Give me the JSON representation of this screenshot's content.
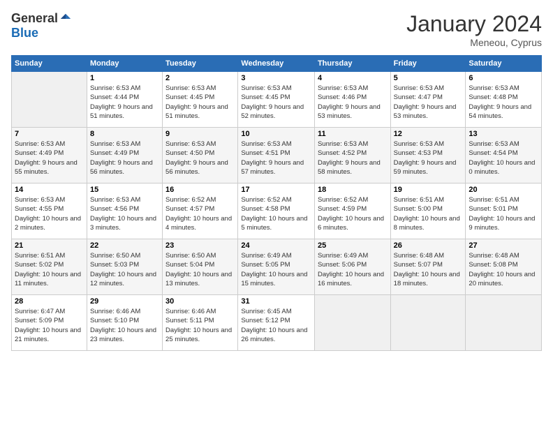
{
  "logo": {
    "general": "General",
    "blue": "Blue"
  },
  "header": {
    "title": "January 2024",
    "subtitle": "Meneou, Cyprus"
  },
  "weekdays": [
    "Sunday",
    "Monday",
    "Tuesday",
    "Wednesday",
    "Thursday",
    "Friday",
    "Saturday"
  ],
  "weeks": [
    [
      {
        "num": "",
        "empty": true
      },
      {
        "num": "1",
        "sunrise": "6:53 AM",
        "sunset": "4:44 PM",
        "daylight": "9 hours and 51 minutes."
      },
      {
        "num": "2",
        "sunrise": "6:53 AM",
        "sunset": "4:45 PM",
        "daylight": "9 hours and 51 minutes."
      },
      {
        "num": "3",
        "sunrise": "6:53 AM",
        "sunset": "4:45 PM",
        "daylight": "9 hours and 52 minutes."
      },
      {
        "num": "4",
        "sunrise": "6:53 AM",
        "sunset": "4:46 PM",
        "daylight": "9 hours and 53 minutes."
      },
      {
        "num": "5",
        "sunrise": "6:53 AM",
        "sunset": "4:47 PM",
        "daylight": "9 hours and 53 minutes."
      },
      {
        "num": "6",
        "sunrise": "6:53 AM",
        "sunset": "4:48 PM",
        "daylight": "9 hours and 54 minutes."
      }
    ],
    [
      {
        "num": "7",
        "sunrise": "6:53 AM",
        "sunset": "4:49 PM",
        "daylight": "9 hours and 55 minutes."
      },
      {
        "num": "8",
        "sunrise": "6:53 AM",
        "sunset": "4:49 PM",
        "daylight": "9 hours and 56 minutes."
      },
      {
        "num": "9",
        "sunrise": "6:53 AM",
        "sunset": "4:50 PM",
        "daylight": "9 hours and 56 minutes."
      },
      {
        "num": "10",
        "sunrise": "6:53 AM",
        "sunset": "4:51 PM",
        "daylight": "9 hours and 57 minutes."
      },
      {
        "num": "11",
        "sunrise": "6:53 AM",
        "sunset": "4:52 PM",
        "daylight": "9 hours and 58 minutes."
      },
      {
        "num": "12",
        "sunrise": "6:53 AM",
        "sunset": "4:53 PM",
        "daylight": "9 hours and 59 minutes."
      },
      {
        "num": "13",
        "sunrise": "6:53 AM",
        "sunset": "4:54 PM",
        "daylight": "10 hours and 0 minutes."
      }
    ],
    [
      {
        "num": "14",
        "sunrise": "6:53 AM",
        "sunset": "4:55 PM",
        "daylight": "10 hours and 2 minutes."
      },
      {
        "num": "15",
        "sunrise": "6:53 AM",
        "sunset": "4:56 PM",
        "daylight": "10 hours and 3 minutes."
      },
      {
        "num": "16",
        "sunrise": "6:52 AM",
        "sunset": "4:57 PM",
        "daylight": "10 hours and 4 minutes."
      },
      {
        "num": "17",
        "sunrise": "6:52 AM",
        "sunset": "4:58 PM",
        "daylight": "10 hours and 5 minutes."
      },
      {
        "num": "18",
        "sunrise": "6:52 AM",
        "sunset": "4:59 PM",
        "daylight": "10 hours and 6 minutes."
      },
      {
        "num": "19",
        "sunrise": "6:51 AM",
        "sunset": "5:00 PM",
        "daylight": "10 hours and 8 minutes."
      },
      {
        "num": "20",
        "sunrise": "6:51 AM",
        "sunset": "5:01 PM",
        "daylight": "10 hours and 9 minutes."
      }
    ],
    [
      {
        "num": "21",
        "sunrise": "6:51 AM",
        "sunset": "5:02 PM",
        "daylight": "10 hours and 11 minutes."
      },
      {
        "num": "22",
        "sunrise": "6:50 AM",
        "sunset": "5:03 PM",
        "daylight": "10 hours and 12 minutes."
      },
      {
        "num": "23",
        "sunrise": "6:50 AM",
        "sunset": "5:04 PM",
        "daylight": "10 hours and 13 minutes."
      },
      {
        "num": "24",
        "sunrise": "6:49 AM",
        "sunset": "5:05 PM",
        "daylight": "10 hours and 15 minutes."
      },
      {
        "num": "25",
        "sunrise": "6:49 AM",
        "sunset": "5:06 PM",
        "daylight": "10 hours and 16 minutes."
      },
      {
        "num": "26",
        "sunrise": "6:48 AM",
        "sunset": "5:07 PM",
        "daylight": "10 hours and 18 minutes."
      },
      {
        "num": "27",
        "sunrise": "6:48 AM",
        "sunset": "5:08 PM",
        "daylight": "10 hours and 20 minutes."
      }
    ],
    [
      {
        "num": "28",
        "sunrise": "6:47 AM",
        "sunset": "5:09 PM",
        "daylight": "10 hours and 21 minutes."
      },
      {
        "num": "29",
        "sunrise": "6:46 AM",
        "sunset": "5:10 PM",
        "daylight": "10 hours and 23 minutes."
      },
      {
        "num": "30",
        "sunrise": "6:46 AM",
        "sunset": "5:11 PM",
        "daylight": "10 hours and 25 minutes."
      },
      {
        "num": "31",
        "sunrise": "6:45 AM",
        "sunset": "5:12 PM",
        "daylight": "10 hours and 26 minutes."
      },
      {
        "num": "",
        "empty": true
      },
      {
        "num": "",
        "empty": true
      },
      {
        "num": "",
        "empty": true
      }
    ]
  ]
}
